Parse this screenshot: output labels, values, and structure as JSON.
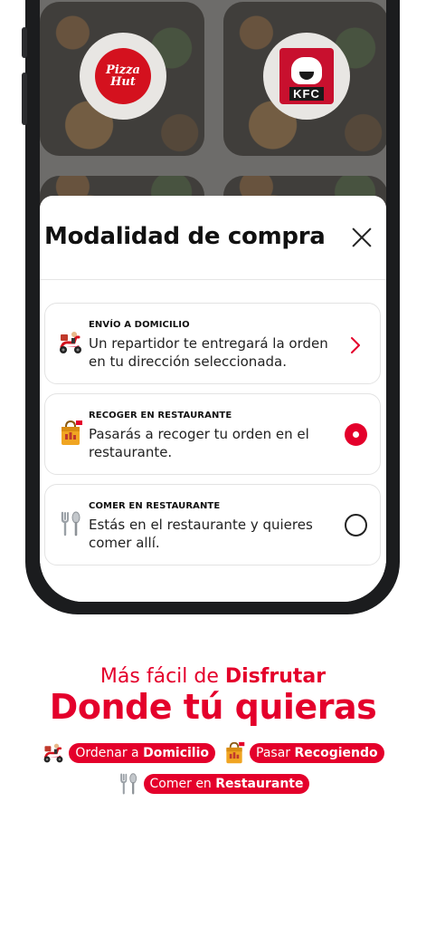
{
  "restaurants": [
    {
      "name": "Pizza Hut",
      "logo_text": "Pizza Hut"
    },
    {
      "name": "KFC",
      "logo_text": "KFC"
    }
  ],
  "modal": {
    "title": "Modalidad de compra",
    "options": [
      {
        "caption": "ENVÍO A DOMICILIO",
        "description": "Un repartidor te entregará la orden en tu dirección seleccionada.",
        "icon": "delivery-scooter-icon",
        "control": "chevron"
      },
      {
        "caption": "RECOGER EN RESTAURANTE",
        "description": "Pasarás a recoger tu orden en el restaurante.",
        "icon": "pickup-bag-icon",
        "control": "radio",
        "selected": true
      },
      {
        "caption": "COMER EN RESTAURANTE",
        "description": "Estás en el restaurante y quieres comer allí.",
        "icon": "utensils-icon",
        "control": "radio",
        "selected": false
      }
    ]
  },
  "promo": {
    "line1_prefix": "Más fácil de ",
    "line1_bold": "Disfrutar",
    "line2": "Donde tú quieras",
    "pills": [
      {
        "prefix": "Ordenar a ",
        "bold": "Domicilio",
        "icon": "delivery-scooter-icon"
      },
      {
        "prefix": "Pasar ",
        "bold": "Recogiendo",
        "icon": "pickup-bag-icon"
      },
      {
        "prefix": "Comer en ",
        "bold": "Restaurante",
        "icon": "utensils-icon"
      }
    ]
  },
  "colors": {
    "accent": "#e4002b",
    "text": "#111111",
    "border": "#e3e3e3"
  }
}
